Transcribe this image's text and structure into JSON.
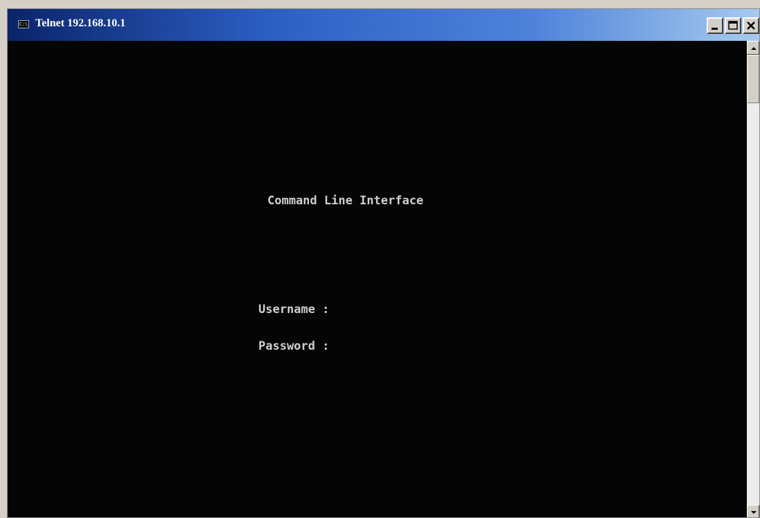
{
  "window": {
    "title": "Telnet 192.168.10.1",
    "icon": "console-icon",
    "icon_text": "C:\\"
  },
  "title_buttons": {
    "minimize_icon": "minimize-icon",
    "maximize_icon": "maximize-icon",
    "close_icon": "close-icon"
  },
  "terminal": {
    "heading": "Command Line Interface",
    "username_prompt": "Username :",
    "password_prompt": "Password :"
  },
  "colors": {
    "terminal_background": "#050505",
    "terminal_text": "#cfcfcf",
    "titlebar_start": "#0a246a",
    "titlebar_end": "#a6caf0"
  }
}
